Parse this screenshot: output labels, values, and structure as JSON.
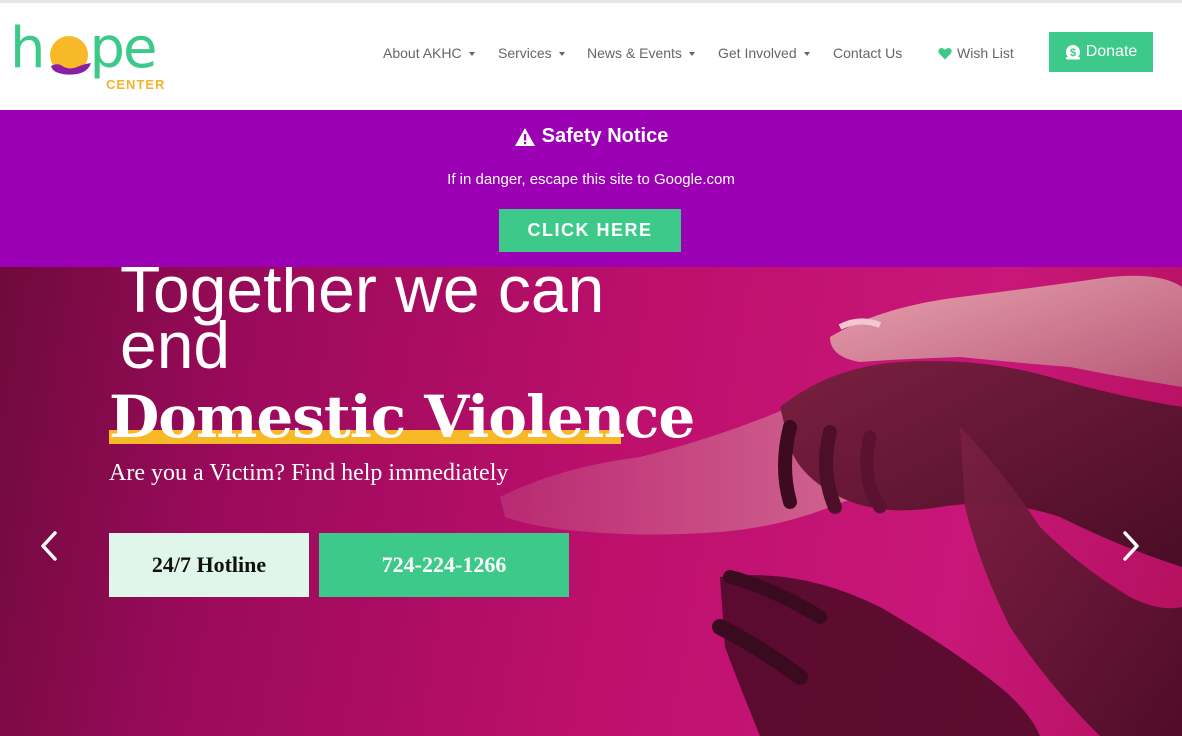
{
  "logo": {
    "word_left": "h",
    "word_right": "pe",
    "subtitle": "CENTER",
    "icon": "sun-hand-logo-icon"
  },
  "nav": {
    "items": [
      {
        "label": "About AKHC",
        "dropdown": true
      },
      {
        "label": "Services",
        "dropdown": true
      },
      {
        "label": "News & Events",
        "dropdown": true
      },
      {
        "label": "Get Involved",
        "dropdown": true
      },
      {
        "label": "Contact Us",
        "dropdown": false
      },
      {
        "label": "Wish List",
        "icon": "heart-icon"
      }
    ],
    "donate_label": "Donate",
    "donate_icon": "money-bag-icon"
  },
  "safety": {
    "title": "Safety Notice",
    "icon": "warning-triangle-icon",
    "text": "If in danger, escape this site to Google.com",
    "button": "CLICK HERE"
  },
  "hero": {
    "line1": "Together we can end",
    "line2": "Domestic Violence",
    "subtitle": "Are you a Victim? Find help immediately",
    "hotline_label": "24/7 Hotline",
    "phone": "724-224-1266",
    "prev_icon": "chevron-left-icon",
    "next_icon": "chevron-right-icon"
  },
  "colors": {
    "brand_green": "#3cc98a",
    "brand_purple": "#9b00b4",
    "accent_yellow": "#f7b928",
    "hero_magenta": "#c0106e"
  }
}
